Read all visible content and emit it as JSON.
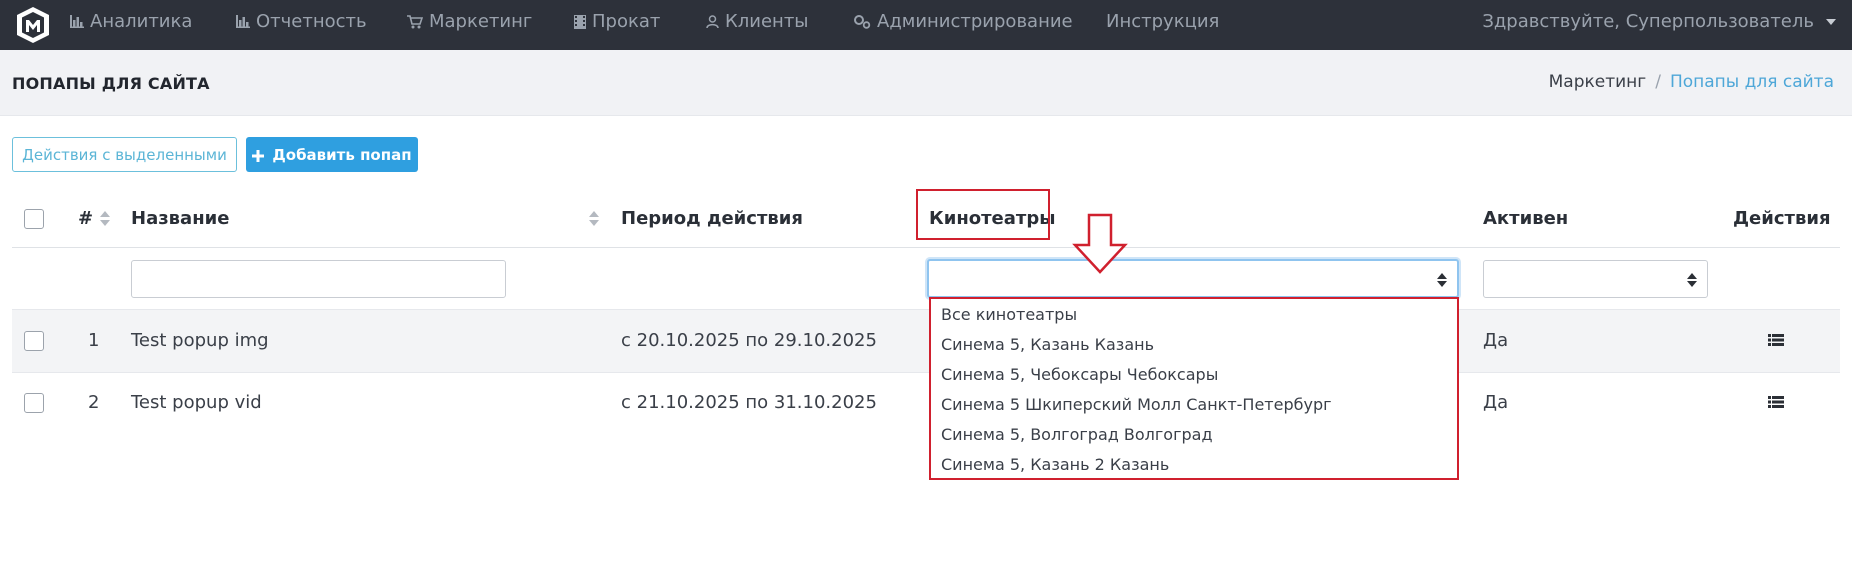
{
  "nav": {
    "items": [
      {
        "label": "Аналитика",
        "icon": "bar-chart-icon"
      },
      {
        "label": "Отчетность",
        "icon": "bar-chart-icon"
      },
      {
        "label": "Маркетинг",
        "icon": "cart-icon"
      },
      {
        "label": "Прокат",
        "icon": "film-icon"
      },
      {
        "label": "Клиенты",
        "icon": "user-icon"
      },
      {
        "label": "Администрирование",
        "icon": "gears-icon"
      },
      {
        "label": "Инструкция",
        "icon": ""
      }
    ],
    "user_greeting": "Здравствуйте, Суперпользователь"
  },
  "header": {
    "title": "ПОПАПЫ ДЛЯ САЙТА",
    "breadcrumb": [
      "Маркетинг",
      "Попапы для сайта"
    ],
    "separator": "/"
  },
  "toolbar": {
    "bulk_actions_label": "Действия с выделенными",
    "add_label": "Добавить попап"
  },
  "table": {
    "columns": [
      "#",
      "Название",
      "Период действия",
      "Кинотеатры",
      "Активен",
      "Действия"
    ],
    "rows": [
      {
        "id": "1",
        "name": "Test popup img",
        "period": "с 20.10.2025 по 29.10.2025",
        "active": "Да"
      },
      {
        "id": "2",
        "name": "Test popup vid",
        "period": "с 21.10.2025 по 31.10.2025",
        "active": "Да"
      }
    ]
  },
  "cinema_dropdown": {
    "options": [
      "Все кинотеатры",
      "Синема 5, Казань Казань",
      "Синема 5, Чебоксары Чебоксары",
      "Синема 5 Шкиперский Молл Санкт-Петербург",
      "Синема 5, Волгоград Волгоград",
      "Синема 5, Казань 2 Казань"
    ]
  },
  "colors": {
    "navbar": "#2d313a",
    "primary": "#2f9fe0",
    "highlight": "#d0202e",
    "link": "#4ea7d8"
  }
}
